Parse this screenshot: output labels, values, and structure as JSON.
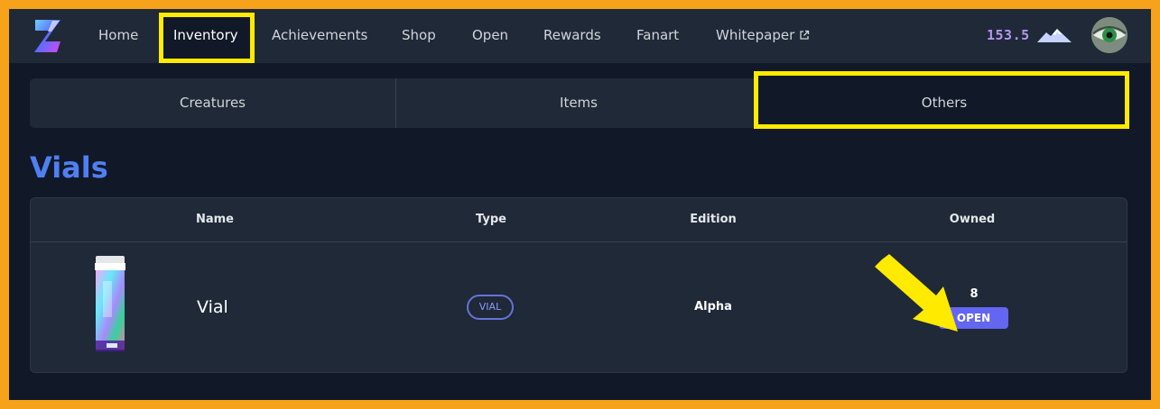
{
  "nav": {
    "items": [
      {
        "label": "Home"
      },
      {
        "label": "Inventory",
        "active": true
      },
      {
        "label": "Achievements"
      },
      {
        "label": "Shop"
      },
      {
        "label": "Open"
      },
      {
        "label": "Rewards"
      },
      {
        "label": "Fanart"
      },
      {
        "label": "Whitepaper",
        "external": true
      }
    ],
    "balance": "153.5",
    "balance_icon": "mountain-icon"
  },
  "tabs": [
    {
      "label": "Creatures"
    },
    {
      "label": "Items"
    },
    {
      "label": "Others",
      "highlighted": true
    }
  ],
  "section": {
    "title": "Vials"
  },
  "table": {
    "columns": [
      "Name",
      "Type",
      "Edition",
      "Owned"
    ],
    "rows": [
      {
        "name": "Vial",
        "type": "VIAL",
        "edition": "Alpha",
        "owned": "8",
        "action": "OPEN"
      }
    ]
  },
  "colors": {
    "frame": "#f7a21b",
    "highlight": "#ffea00",
    "accent": "#6366f1",
    "heading": "#4f7ff2",
    "balance": "#b596f0"
  }
}
